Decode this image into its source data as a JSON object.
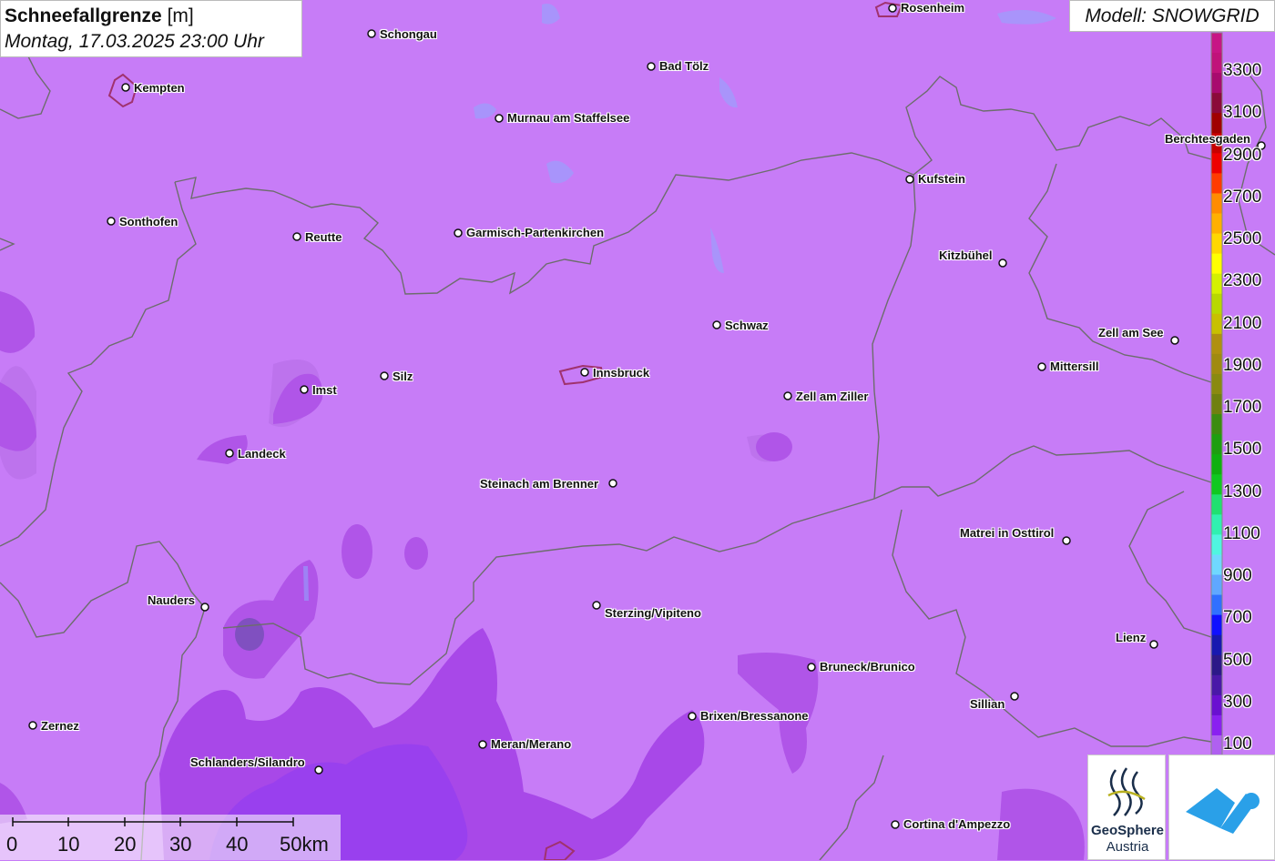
{
  "title": {
    "main": "Schneefallgrenze",
    "unit": "[m]",
    "datetime": "Montag, 17.03.2025 23:00 Uhr"
  },
  "model_label": "Modell: SNOWGRID",
  "cities": [
    {
      "name": "Rosenheim"
    },
    {
      "name": "Schongau"
    },
    {
      "name": "Kempten"
    },
    {
      "name": "Bad Tölz"
    },
    {
      "name": "Murnau am Staffelsee"
    },
    {
      "name": "Berchtesgaden"
    },
    {
      "name": "Kufstein"
    },
    {
      "name": "Sonthofen"
    },
    {
      "name": "Reutte"
    },
    {
      "name": "Garmisch-Partenkirchen"
    },
    {
      "name": "Kitzbühel"
    },
    {
      "name": "Schwaz"
    },
    {
      "name": "Zell am See"
    },
    {
      "name": "Mittersill"
    },
    {
      "name": "Innsbruck"
    },
    {
      "name": "Silz"
    },
    {
      "name": "Imst"
    },
    {
      "name": "Zell am Ziller"
    },
    {
      "name": "Landeck"
    },
    {
      "name": "Steinach am Brenner"
    },
    {
      "name": "Matrei in Osttirol"
    },
    {
      "name": "Nauders"
    },
    {
      "name": "Sterzing/Vipiteno"
    },
    {
      "name": "Lienz"
    },
    {
      "name": "Bruneck/Brunico"
    },
    {
      "name": "Sillian"
    },
    {
      "name": "Zernez"
    },
    {
      "name": "Brixen/Bressanone"
    },
    {
      "name": "Meran/Merano"
    },
    {
      "name": "Schlanders/Silandro"
    },
    {
      "name": "Cortina d'Ampezzo"
    }
  ],
  "legend": {
    "labels": [
      "3300",
      "3100",
      "2900",
      "2700",
      "2500",
      "2300",
      "2100",
      "1900",
      "1700",
      "1500",
      "1300",
      "1100",
      "900",
      "700",
      "500",
      "300",
      "100"
    ],
    "colors": [
      "#c71585",
      "#c0127a",
      "#a80a6e",
      "#8b0a3a",
      "#a00000",
      "#c80000",
      "#ee0000",
      "#ff3b00",
      "#ff8c00",
      "#ffb000",
      "#ffd700",
      "#ffff00",
      "#d4f000",
      "#b8d800",
      "#c8c000",
      "#b09010",
      "#a08a10",
      "#8a8a10",
      "#708010",
      "#3c8c10",
      "#1e9e10",
      "#10b010",
      "#10c820",
      "#20e070",
      "#30f0b0",
      "#50f5e0",
      "#70d8ff",
      "#60a8ff",
      "#3070ff",
      "#1010ff",
      "#1818b0",
      "#2c1888",
      "#4a18a8",
      "#6a10d0",
      "#8a20f0",
      "#b060f0"
    ]
  },
  "scale": {
    "ticks": [
      "0",
      "10",
      "20",
      "30",
      "40",
      "50km"
    ]
  },
  "logos": {
    "geosphere_line1": "GeoSphere",
    "geosphere_line2": "Austria"
  }
}
